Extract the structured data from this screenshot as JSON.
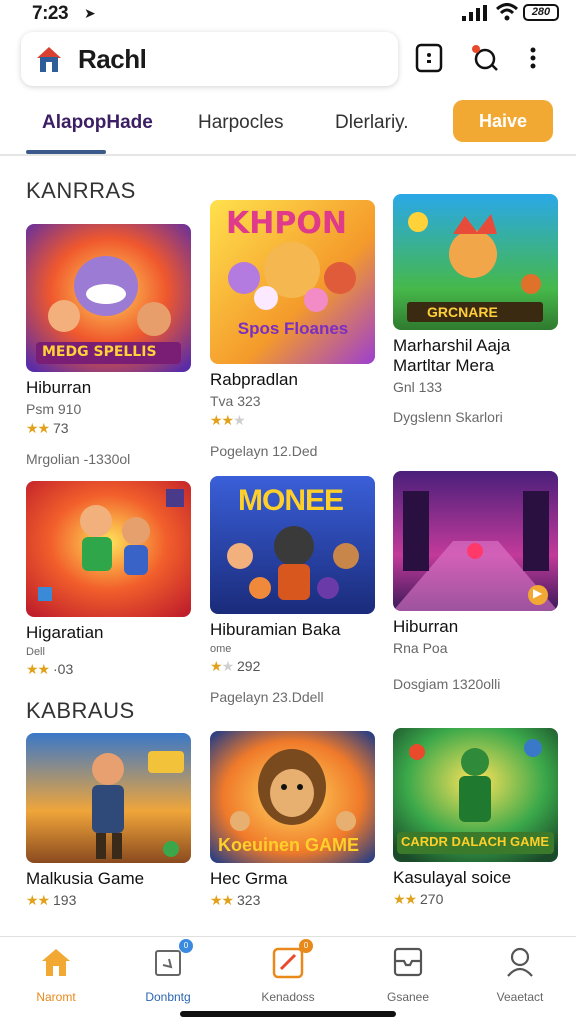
{
  "status_bar": {
    "time": "7:23",
    "battery": "280"
  },
  "app_bar": {
    "title": "Rachl"
  },
  "tabs": [
    {
      "label": "AlapopHade"
    },
    {
      "label": "Harpocles"
    },
    {
      "label": "Dlerlariy."
    },
    {
      "label": "Haive"
    }
  ],
  "sections": [
    {
      "title": "KANRRAS"
    },
    {
      "title": "KABRAUS"
    }
  ],
  "cards": [
    {
      "thumb_title": "MEDG SPELLIS",
      "name": "Hiburran",
      "sub": "Psm 910",
      "rating_value": 3,
      "rating_text": "73",
      "meta": "Mrgolian -1330ol"
    },
    {
      "thumb_title": "KHPON",
      "thumb_subtitle": "Spos Floanes",
      "name": "Rabpradlan",
      "sub": "Tva 323",
      "rating_value": 2.5,
      "rating_text": "",
      "meta": "Pogelayn 12.Ded"
    },
    {
      "thumb_title": "GRCNARE",
      "name": "Marharshil Aaja Martltar Mera",
      "sub": "Gnl 133",
      "rating_value": 0,
      "rating_text": "",
      "meta": "Dygslenn Skarlori"
    },
    {
      "thumb_title": "",
      "name": "Higaratian",
      "sub": "Dell",
      "rating_value": 2,
      "rating_text": "·03",
      "meta": ""
    },
    {
      "thumb_title": "MONEE",
      "name": "Hiburamian Baka",
      "sub": "ome",
      "rating_value": 1.5,
      "rating_text": "292",
      "meta": "Pagelayn 23.Ddell"
    },
    {
      "thumb_title": "",
      "name": "Hiburran",
      "sub": "Rna Poa",
      "rating_value": 0,
      "rating_text": "",
      "meta": "Dosgiam 1320olli"
    },
    {
      "thumb_title": "",
      "name": "Malkusia Game",
      "sub": "",
      "rating_value": 2,
      "rating_text": "193",
      "meta": ""
    },
    {
      "thumb_title": "Koeuinen GAME",
      "name": "Hec Grma",
      "sub": "",
      "rating_value": 2,
      "rating_text": "323",
      "meta": ""
    },
    {
      "thumb_title": "CARDR DALACH GAME",
      "name": "Kasulayal soice",
      "sub": "",
      "rating_value": 2,
      "rating_text": "270",
      "meta": ""
    }
  ],
  "bottom_nav": [
    {
      "label": "Naromt",
      "icon": "home-icon"
    },
    {
      "label": "Donbntg",
      "icon": "gallery-icon",
      "badge": "0"
    },
    {
      "label": "Kenadoss",
      "icon": "edit-icon",
      "badge": "0"
    },
    {
      "label": "Gsanee",
      "icon": "inbox-icon"
    },
    {
      "label": "Veaetact",
      "icon": "profile-icon"
    }
  ],
  "colors": {
    "accent": "#f2a933",
    "active_tab": "#3b1e63",
    "nav_active": "#e8891a",
    "star": "#e0a21b"
  }
}
